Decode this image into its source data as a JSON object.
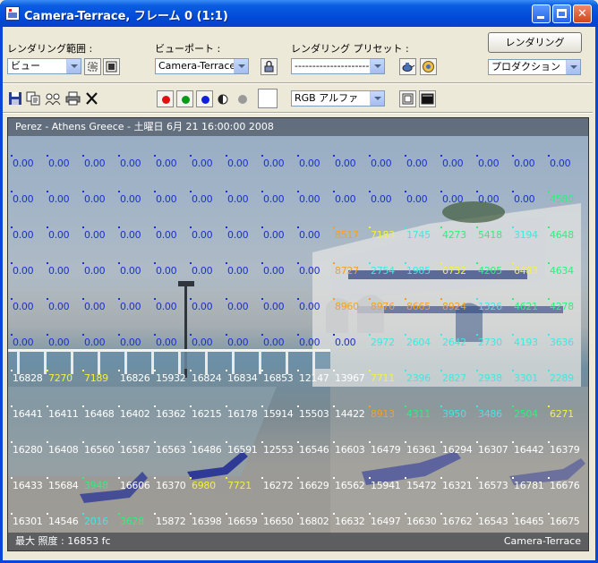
{
  "window": {
    "title": "Camera-Terrace, フレーム 0 (1:1)",
    "min_label": "",
    "max_label": "",
    "close_label": "✕"
  },
  "toolbar": {
    "render_area_label": "レンダリング範囲 :",
    "render_area_value": "ビュー",
    "viewport_label": "ビューポート :",
    "viewport_value": "Camera-Terrace",
    "preset_label": "レンダリング プリセット :",
    "preset_value": "----------------------",
    "render_button": "レンダリング",
    "production_value": "プロダクション",
    "channel_value": "RGB アルファ"
  },
  "icons": {
    "save": "save-icon",
    "copy": "copy-icon",
    "clone": "clone-icon",
    "print": "print-icon",
    "clear": "clear-icon",
    "lock": "lock-icon",
    "teapot": "teapot-icon",
    "environment": "environment-icon"
  },
  "colors": {
    "zero": "#1a2fd6",
    "orange": "#f5a020",
    "yellow": "#f4f23a",
    "cyan": "#3ee8e2",
    "green": "#2ef07a",
    "white": "#ffffff"
  },
  "viewport": {
    "header": "Perez - Athens Greece - 土曜日 6月 21 16:00:00 2008",
    "footer_left": "最大 照度 : 16853 fc",
    "footer_right": "Camera-Terrace",
    "grid": [
      [
        [
          "0.00",
          "b"
        ],
        [
          "0.00",
          "b"
        ],
        [
          "0.00",
          "b"
        ],
        [
          "0.00",
          "b"
        ],
        [
          "0.00",
          "b"
        ],
        [
          "0.00",
          "b"
        ],
        [
          "0.00",
          "b"
        ],
        [
          "0.00",
          "b"
        ],
        [
          "0.00",
          "b"
        ],
        [
          "0.00",
          "b"
        ],
        [
          "0.00",
          "b"
        ],
        [
          "0.00",
          "b"
        ],
        [
          "0.00",
          "b"
        ],
        [
          "0.00",
          "b"
        ],
        [
          "0.00",
          "b"
        ],
        [
          "0.00",
          "b"
        ]
      ],
      [
        [
          "0.00",
          "b"
        ],
        [
          "0.00",
          "b"
        ],
        [
          "0.00",
          "b"
        ],
        [
          "0.00",
          "b"
        ],
        [
          "0.00",
          "b"
        ],
        [
          "0.00",
          "b"
        ],
        [
          "0.00",
          "b"
        ],
        [
          "0.00",
          "b"
        ],
        [
          "0.00",
          "b"
        ],
        [
          "0.00",
          "b"
        ],
        [
          "0.00",
          "b"
        ],
        [
          "0.00",
          "b"
        ],
        [
          "0.00",
          "b"
        ],
        [
          "0.00",
          "b"
        ],
        [
          "0.00",
          "b"
        ],
        [
          "4580",
          "g"
        ]
      ],
      [
        [
          "0.00",
          "b"
        ],
        [
          "0.00",
          "b"
        ],
        [
          "0.00",
          "b"
        ],
        [
          "0.00",
          "b"
        ],
        [
          "0.00",
          "b"
        ],
        [
          "0.00",
          "b"
        ],
        [
          "0.00",
          "b"
        ],
        [
          "0.00",
          "b"
        ],
        [
          "0.00",
          "b"
        ],
        [
          "8517",
          "o"
        ],
        [
          "7183",
          "y"
        ],
        [
          "1745",
          "c"
        ],
        [
          "4273",
          "g"
        ],
        [
          "5418",
          "g"
        ],
        [
          "3194",
          "c"
        ],
        [
          "4648",
          "g"
        ]
      ],
      [
        [
          "0.00",
          "b"
        ],
        [
          "0.00",
          "b"
        ],
        [
          "0.00",
          "b"
        ],
        [
          "0.00",
          "b"
        ],
        [
          "0.00",
          "b"
        ],
        [
          "0.00",
          "b"
        ],
        [
          "0.00",
          "b"
        ],
        [
          "0.00",
          "b"
        ],
        [
          "0.00",
          "b"
        ],
        [
          "8727",
          "o"
        ],
        [
          "2754",
          "c"
        ],
        [
          "1985",
          "c"
        ],
        [
          "6732",
          "y"
        ],
        [
          "4205",
          "g"
        ],
        [
          "6483",
          "y"
        ],
        [
          "4634",
          "g"
        ]
      ],
      [
        [
          "0.00",
          "b"
        ],
        [
          "0.00",
          "b"
        ],
        [
          "0.00",
          "b"
        ],
        [
          "0.00",
          "b"
        ],
        [
          "0.00",
          "b"
        ],
        [
          "0.00",
          "b"
        ],
        [
          "0.00",
          "b"
        ],
        [
          "0.00",
          "b"
        ],
        [
          "0.00",
          "b"
        ],
        [
          "8960",
          "o"
        ],
        [
          "8976",
          "o"
        ],
        [
          "8665",
          "o"
        ],
        [
          "8924",
          "o"
        ],
        [
          "1326",
          "c"
        ],
        [
          "4621",
          "g"
        ],
        [
          "4278",
          "g"
        ]
      ],
      [
        [
          "0.00",
          "b"
        ],
        [
          "0.00",
          "b"
        ],
        [
          "0.00",
          "b"
        ],
        [
          "0.00",
          "b"
        ],
        [
          "0.00",
          "b"
        ],
        [
          "0.00",
          "b"
        ],
        [
          "0.00",
          "b"
        ],
        [
          "0.00",
          "b"
        ],
        [
          "0.00",
          "b"
        ],
        [
          "0.00",
          "b"
        ],
        [
          "2972",
          "c"
        ],
        [
          "2604",
          "c"
        ],
        [
          "2642",
          "c"
        ],
        [
          "2730",
          "c"
        ],
        [
          "4193",
          "c"
        ],
        [
          "3636",
          "c"
        ]
      ],
      [
        [
          "16828",
          "w"
        ],
        [
          "7270",
          "y"
        ],
        [
          "7189",
          "y"
        ],
        [
          "16826",
          "w"
        ],
        [
          "15932",
          "w"
        ],
        [
          "16824",
          "w"
        ],
        [
          "16834",
          "w"
        ],
        [
          "16853",
          "w"
        ],
        [
          "12147",
          "w"
        ],
        [
          "13967",
          "w"
        ],
        [
          "7711",
          "y"
        ],
        [
          "2396",
          "c"
        ],
        [
          "2827",
          "c"
        ],
        [
          "2938",
          "c"
        ],
        [
          "3301",
          "c"
        ],
        [
          "2289",
          "c"
        ]
      ],
      [
        [
          "16441",
          "w"
        ],
        [
          "16411",
          "w"
        ],
        [
          "16468",
          "w"
        ],
        [
          "16402",
          "w"
        ],
        [
          "16362",
          "w"
        ],
        [
          "16215",
          "w"
        ],
        [
          "16178",
          "w"
        ],
        [
          "15914",
          "w"
        ],
        [
          "15503",
          "w"
        ],
        [
          "14422",
          "w"
        ],
        [
          "8913",
          "o"
        ],
        [
          "4311",
          "g"
        ],
        [
          "3950",
          "c"
        ],
        [
          "3486",
          "c"
        ],
        [
          "2504",
          "g"
        ],
        [
          "6271",
          "y"
        ]
      ],
      [
        [
          "16280",
          "w"
        ],
        [
          "16408",
          "w"
        ],
        [
          "16560",
          "w"
        ],
        [
          "16587",
          "w"
        ],
        [
          "16563",
          "w"
        ],
        [
          "16486",
          "w"
        ],
        [
          "16591",
          "w"
        ],
        [
          "12553",
          "w"
        ],
        [
          "16546",
          "w"
        ],
        [
          "16603",
          "w"
        ],
        [
          "16479",
          "w"
        ],
        [
          "16361",
          "w"
        ],
        [
          "16294",
          "w"
        ],
        [
          "16307",
          "w"
        ],
        [
          "16442",
          "w"
        ],
        [
          "16379",
          "w"
        ]
      ],
      [
        [
          "16433",
          "w"
        ],
        [
          "15684",
          "w"
        ],
        [
          "3948",
          "g"
        ],
        [
          "16606",
          "w"
        ],
        [
          "16370",
          "w"
        ],
        [
          "6980",
          "y"
        ],
        [
          "7721",
          "y"
        ],
        [
          "16272",
          "w"
        ],
        [
          "16629",
          "w"
        ],
        [
          "16562",
          "w"
        ],
        [
          "15941",
          "w"
        ],
        [
          "15472",
          "w"
        ],
        [
          "16321",
          "w"
        ],
        [
          "16573",
          "w"
        ],
        [
          "16781",
          "w"
        ],
        [
          "16676",
          "w"
        ]
      ],
      [
        [
          "16301",
          "w"
        ],
        [
          "14546",
          "w"
        ],
        [
          "2016",
          "c"
        ],
        [
          "3628",
          "g"
        ],
        [
          "15872",
          "w"
        ],
        [
          "16398",
          "w"
        ],
        [
          "16659",
          "w"
        ],
        [
          "16650",
          "w"
        ],
        [
          "16802",
          "w"
        ],
        [
          "16632",
          "w"
        ],
        [
          "16497",
          "w"
        ],
        [
          "16630",
          "w"
        ],
        [
          "16762",
          "w"
        ],
        [
          "16543",
          "w"
        ],
        [
          "16465",
          "w"
        ],
        [
          "16675",
          "w"
        ]
      ]
    ]
  }
}
